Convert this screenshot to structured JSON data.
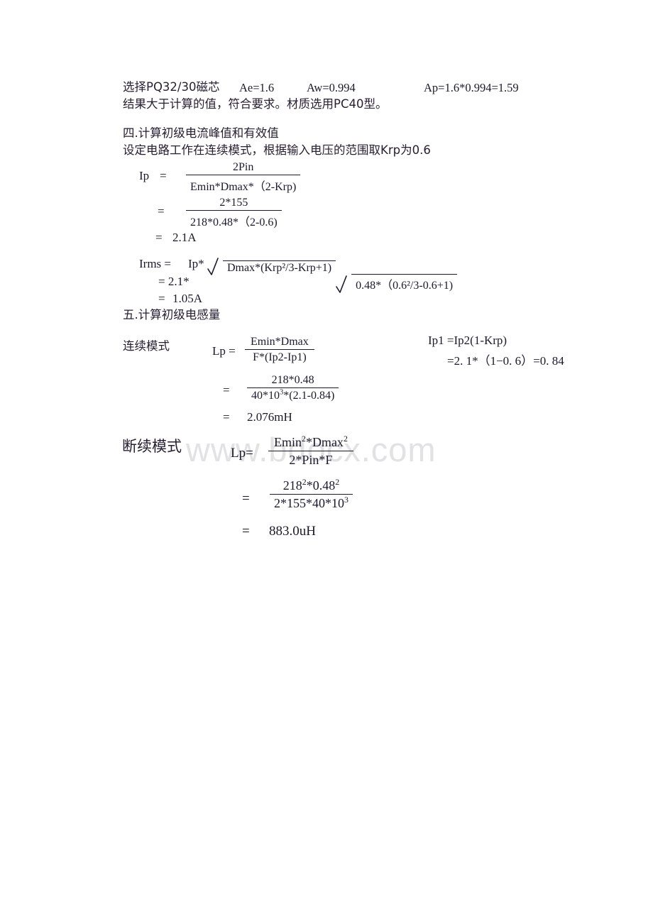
{
  "document": {
    "watermark": "www.bdocx.com",
    "core_selection": {
      "label": "选择PQ32/30磁芯",
      "ae": "Ae=1.6",
      "aw": "Aw=0.994",
      "ap": "Ap=1.6*0.994=1.59",
      "note": "结果大于计算的值，符合要求。材质选用PC40型。"
    },
    "section_four": {
      "heading": "四.计算初级电流峰值和有效值",
      "intro": "设定电路工作在连续模式，根据输入电压的范围取Krp为0.6",
      "ip": {
        "label": "Ip",
        "eq1": "=",
        "numerator1": "2Pin",
        "denominator1": "Emin*Dmax*（2-Krp)",
        "eq2": "=",
        "numerator2": "2*155",
        "denominator2": "218*0.48*（2-0.6)",
        "eq3": "=",
        "result": "2.1A"
      },
      "irms": {
        "label": "Irms =",
        "coefficient1": "Ip*",
        "radicand1": "Dmax*(Krp²/3-Krp+1)",
        "eq2": "= 2.1*",
        "radicand2": "0.48*（0.6²/3-0.6+1)",
        "eq3": "=",
        "result": "1.05A"
      }
    },
    "section_five": {
      "heading": "五.计算初级电感量",
      "continuous": {
        "mode_label": "连续模式",
        "lp_label": "Lp =",
        "numerator1": "Emin*Dmax",
        "denominator1": "F*(Ip2-Ip1)",
        "eq2": "=",
        "numerator2": "218*0.48",
        "denominator2_pre": "40*10",
        "denominator2_sup": "3",
        "denominator2_post": "*(2.1-0.84)",
        "eq3": "=",
        "result": "2.076mH",
        "side_line1": "Ip1 =Ip2(1-Krp)",
        "side_line2": "=2. 1*（1−0. 6）=0. 84"
      },
      "discontinuous": {
        "mode_label": "断续模式",
        "lp_label": "Lp=",
        "numerator1_pre": "Emin",
        "numerator1_sup1": "2",
        "numerator1_mid": "*Dmax",
        "numerator1_sup2": "2",
        "denominator1": "2*Pin*F",
        "eq2": "=",
        "numerator2_pre": "218",
        "numerator2_sup1": "2",
        "numerator2_mid": "*0.48",
        "numerator2_sup2": "2",
        "denominator2_pre": "2*155*40*10",
        "denominator2_sup": "3",
        "eq3": "=",
        "result": "883.0uH"
      }
    }
  }
}
